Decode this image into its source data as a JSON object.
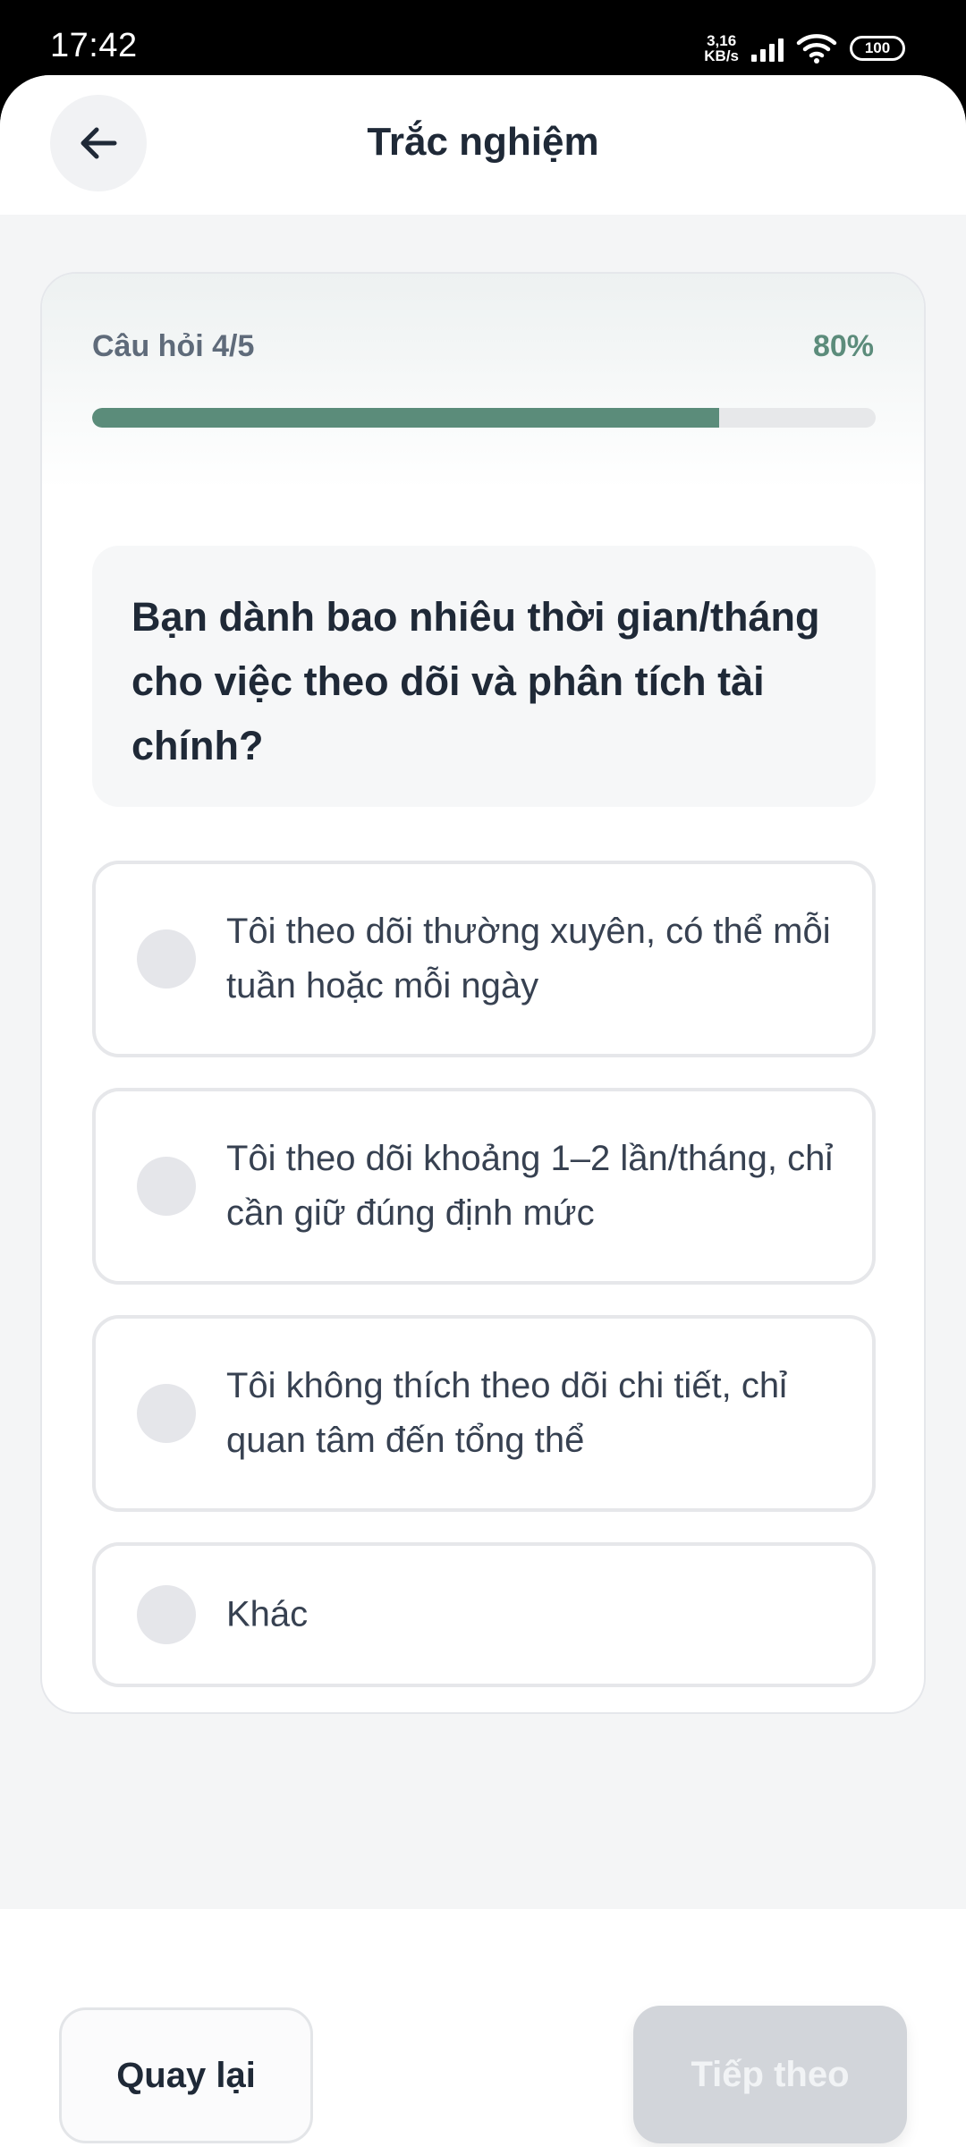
{
  "status_bar": {
    "time": "17:42",
    "net_speed_value": "3,16",
    "net_speed_unit": "KB/s",
    "battery": "100"
  },
  "header": {
    "title": "Trắc nghiệm",
    "back_icon": "arrow-left-icon"
  },
  "progress": {
    "label": "Câu hỏi 4/5",
    "percent_text": "80%",
    "fraction": 0.8,
    "fill_color": "#5b8c7a"
  },
  "question": {
    "text": "Bạn dành bao nhiêu thời gian/tháng cho việc theo dõi và phân tích tài chính?"
  },
  "options": [
    {
      "label": "Tôi theo dõi thường xuyên, có thể mỗi tuần hoặc mỗi ngày",
      "selected": false
    },
    {
      "label": "Tôi theo dõi khoảng 1–2 lần/tháng, chỉ cần giữ đúng định mức",
      "selected": false
    },
    {
      "label": "Tôi không thích theo dõi chi tiết, chỉ quan tâm đến tổng thể",
      "selected": false
    },
    {
      "label": "Khác",
      "selected": false
    }
  ],
  "footer": {
    "back_label": "Quay lại",
    "next_label": "Tiếp theo",
    "next_disabled": true
  }
}
